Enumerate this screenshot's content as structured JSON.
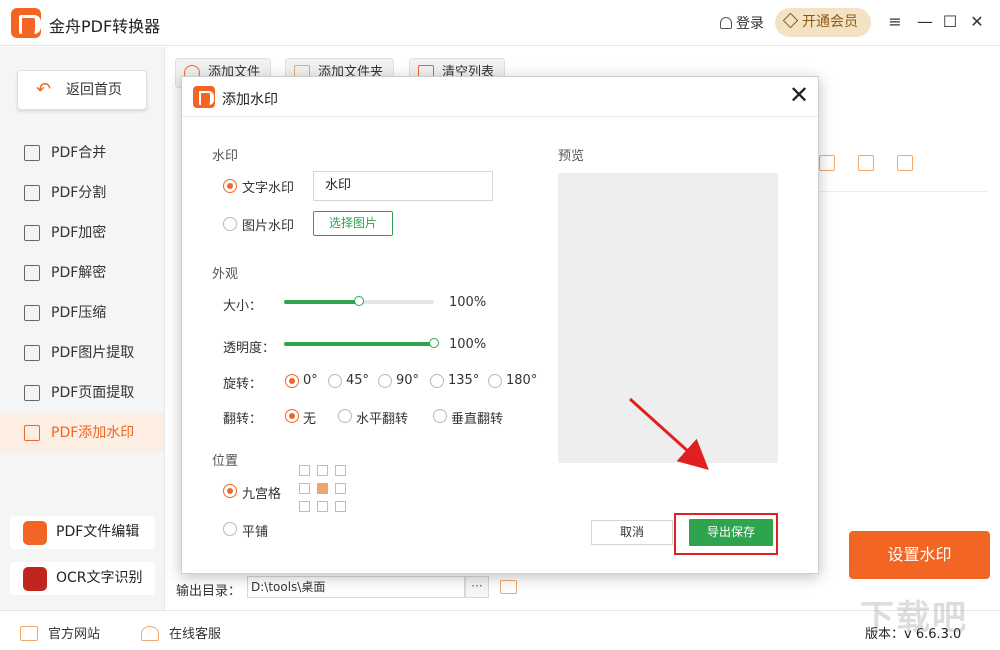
{
  "app": {
    "title": "金舟PDF转换器",
    "login": "登录",
    "vip": "开通会员"
  },
  "sidebar": {
    "back": "返回首页",
    "items": [
      {
        "label": "PDF合并"
      },
      {
        "label": "PDF分割"
      },
      {
        "label": "PDF加密"
      },
      {
        "label": "PDF解密"
      },
      {
        "label": "PDF压缩"
      },
      {
        "label": "PDF图片提取"
      },
      {
        "label": "PDF页面提取"
      },
      {
        "label": "PDF添加水印"
      }
    ],
    "active_index": 7,
    "tools": [
      {
        "label": "PDF文件编辑"
      },
      {
        "label": "OCR文字识别"
      }
    ]
  },
  "toolbar": {
    "add_file": "添加文件",
    "add_folder": "添加文件夹",
    "clear_list": "清空列表"
  },
  "output": {
    "label": "输出目录：",
    "path": "D:\\tools\\桌面",
    "more": "···"
  },
  "action": {
    "set_watermark": "设置水印"
  },
  "footer": {
    "website": "官方网站",
    "service": "在线客服",
    "version": "版本：v 6.6.3.0"
  },
  "site_logo": "下载吧",
  "dialog": {
    "title": "添加水印",
    "watermark_section": "水印",
    "text_watermark": "文字水印",
    "text_value": "水印",
    "image_watermark": "图片水印",
    "choose_image": "选择图片",
    "appearance_section": "外观",
    "size_label": "大小：",
    "size_value": "100%",
    "size_fraction": 0.5,
    "opacity_label": "透明度：",
    "opacity_value": "100%",
    "opacity_fraction": 1.0,
    "rotate_label": "旋转：",
    "rotate_options": [
      "0°",
      "45°",
      "90°",
      "135°",
      "180°"
    ],
    "rotate_selected": "0°",
    "flip_label": "翻转：",
    "flip_options": [
      "无",
      "水平翻转",
      "垂直翻转"
    ],
    "flip_selected": "无",
    "position_section": "位置",
    "nine_grid": "九宫格",
    "tile": "平铺",
    "preview_label": "预览",
    "cancel": "取消",
    "export_save": "导出保存"
  },
  "colors": {
    "brand": "#f26522",
    "green": "#2ea44f",
    "highlight": "#e02020"
  }
}
